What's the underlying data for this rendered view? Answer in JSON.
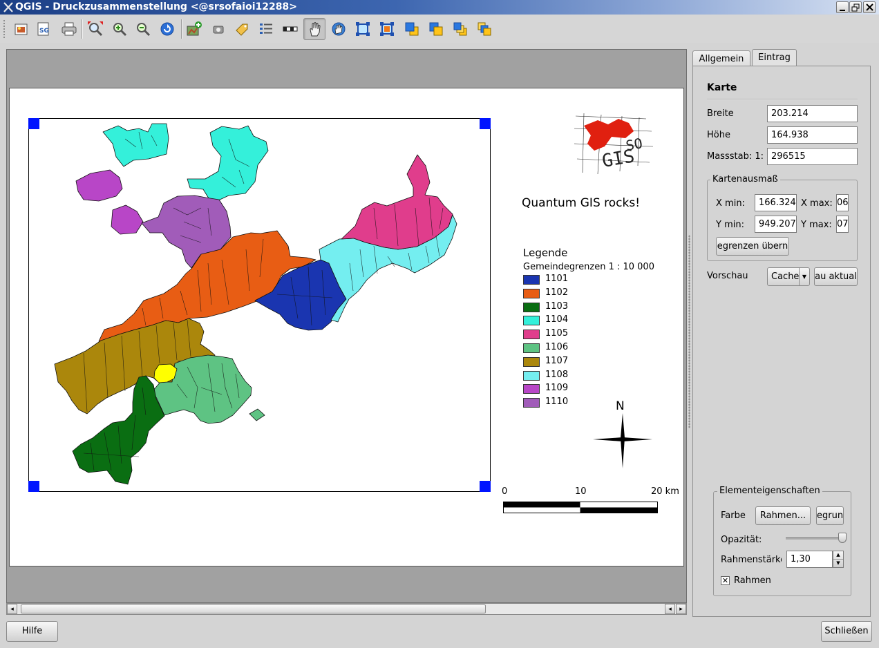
{
  "window": {
    "title": "QGIS - Druckzusammenstellung <@srsofaioi12288>"
  },
  "toolbar": {
    "tools": [
      "export-image-icon",
      "export-svg-icon",
      "print-icon",
      "zoom-full-icon",
      "zoom-in-icon",
      "zoom-out-icon",
      "refresh-icon",
      "add-map-icon",
      "add-image-icon",
      "add-label-icon",
      "add-legend-icon",
      "add-scalebar-icon",
      "select-move-icon",
      "move-content-icon",
      "group-icon",
      "ungroup-icon",
      "raise-icon",
      "lower-icon",
      "move-top-icon",
      "move-bottom-icon"
    ],
    "active_tool": "select-move-icon"
  },
  "composition": {
    "label_text": "Quantum GIS rocks!",
    "logo_text": "GIS",
    "logo_sub": "SO",
    "north_label": "N",
    "legend": {
      "title": "Legende",
      "layer": "Gemeindegrenzen 1 : 10 000",
      "items": [
        {
          "label": "1101",
          "color": "#1a35b0"
        },
        {
          "label": "1102",
          "color": "#e85d14"
        },
        {
          "label": "1103",
          "color": "#0a6e12"
        },
        {
          "label": "1104",
          "color": "#34f0da"
        },
        {
          "label": "1105",
          "color": "#e03d8c"
        },
        {
          "label": "1106",
          "color": "#5ec383"
        },
        {
          "label": "1107",
          "color": "#ab870c"
        },
        {
          "label": "1108",
          "color": "#74eef0"
        },
        {
          "label": "1109",
          "color": "#b846c7"
        },
        {
          "label": "1110",
          "color": "#a15cb9"
        }
      ],
      "highlight_color": "#ffff00"
    },
    "scalebar": {
      "labels": [
        "0",
        "10",
        "20 km"
      ]
    }
  },
  "panel": {
    "tabs": [
      {
        "label": "Allgemein",
        "active": false
      },
      {
        "label": "Eintrag",
        "active": true
      }
    ],
    "section_title": "Karte",
    "breite_label": "Breite",
    "breite_value": "203.214",
    "hoehe_label": "Höhe",
    "hoehe_value": "164.938",
    "massstab_label": "Massstab: 1:",
    "massstab_value": "296515",
    "extent": {
      "title": "Kartenausmaß",
      "xmin_label": "X min:",
      "xmin_value": "166.324",
      "xmax_label": "X max:",
      "xmax_value": "06",
      "ymin_label": "Y min:",
      "ymin_value": "949.207",
      "ymax_label": "Y max:",
      "ymax_value": "07",
      "apply_label": "egrenzen übern"
    },
    "preview_label": "Vorschau",
    "preview_select": "Cache",
    "refresh_label": "au aktual",
    "props": {
      "title": "Elementeigenschaften",
      "farbe_label": "Farbe",
      "frame_button": "Rahmen...",
      "bg_button": "egrun",
      "opacity_label": "Opazität:",
      "opacity_value": 1.0,
      "frame_width_label": "Rahmenstärke",
      "frame_width_value": "1,30",
      "frame_check_label": "Rahmen",
      "frame_checked": true
    }
  },
  "buttons": {
    "help": "Hilfe",
    "close": "Schließen"
  }
}
